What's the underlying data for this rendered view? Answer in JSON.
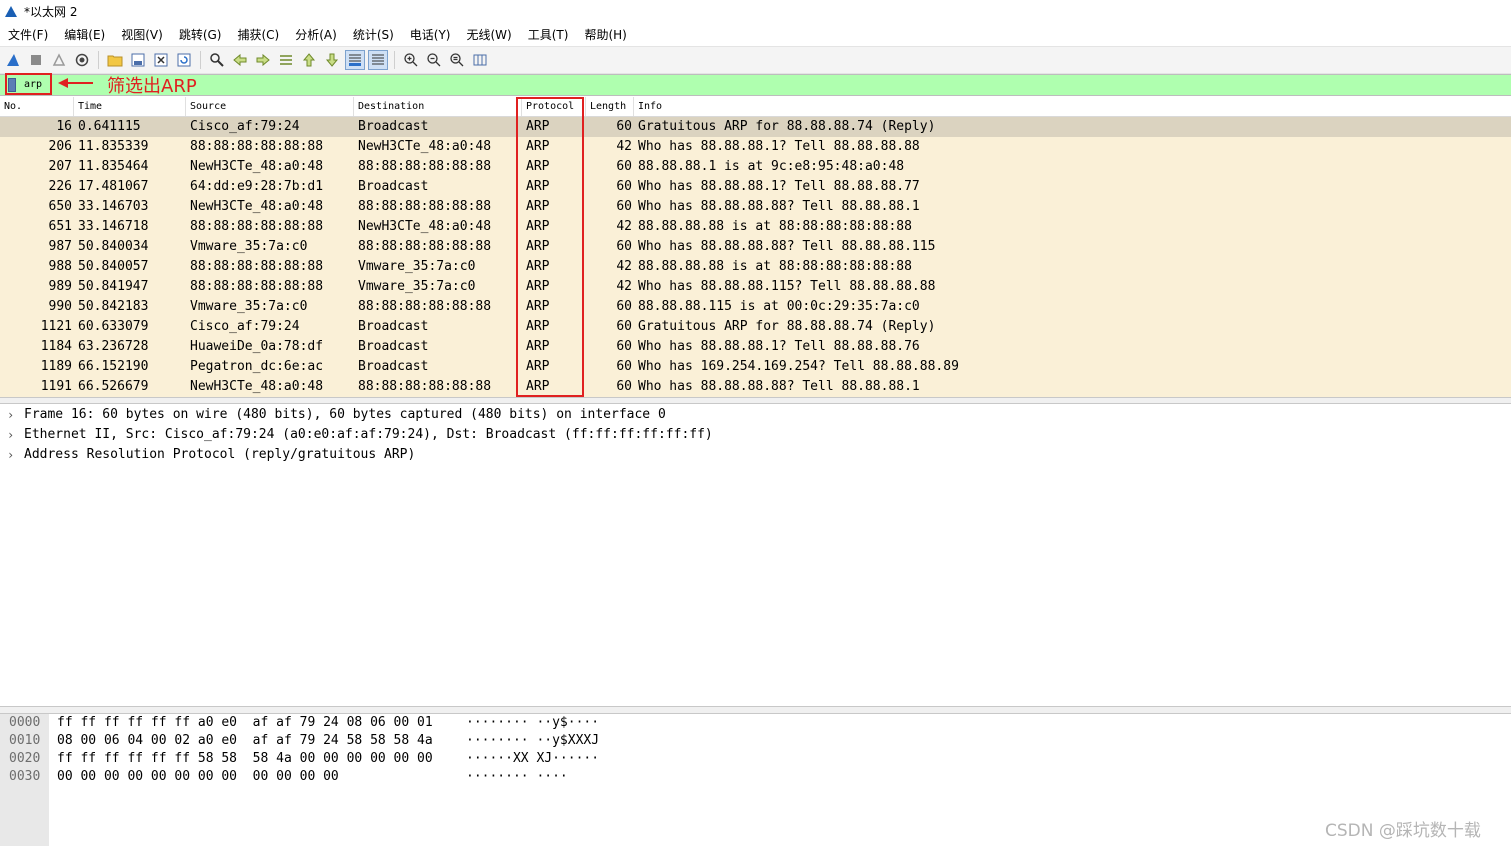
{
  "window": {
    "title": "*以太网 2"
  },
  "menubar": [
    "文件(F)",
    "编辑(E)",
    "视图(V)",
    "跳转(G)",
    "捕获(C)",
    "分析(A)",
    "统计(S)",
    "电话(Y)",
    "无线(W)",
    "工具(T)",
    "帮助(H)"
  ],
  "toolbar": {
    "icons": [
      "shark-fin-start-icon",
      "stop-capture-icon",
      "restart-capture-icon",
      "capture-options-icon",
      "open-file-icon",
      "save-file-icon",
      "close-file-icon",
      "reload-file-icon",
      "find-packet-icon",
      "go-back-icon",
      "go-forward-icon",
      "go-to-packet-icon",
      "go-first-packet-icon",
      "go-last-packet-icon",
      "autoscroll-icon",
      "colorize-icon",
      "zoom-in-icon",
      "zoom-out-icon",
      "zoom-normal-icon",
      "resize-columns-icon"
    ]
  },
  "filter": {
    "value": "arp",
    "bg_color": "#afffaf"
  },
  "annotation": {
    "text": "筛选出ARP",
    "color": "#e02020"
  },
  "packet_list": {
    "columns": [
      "No.",
      "Time",
      "Source",
      "Destination",
      "Protocol",
      "Length",
      "Info"
    ],
    "rows": [
      {
        "no": "16",
        "time": "0.641115",
        "src": "Cisco_af:79:24",
        "dst": "Broadcast",
        "proto": "ARP",
        "len": "60",
        "info": "Gratuitous ARP for 88.88.88.74 (Reply)",
        "selected": true
      },
      {
        "no": "206",
        "time": "11.835339",
        "src": "88:88:88:88:88:88",
        "dst": "NewH3CTe_48:a0:48",
        "proto": "ARP",
        "len": "42",
        "info": "Who has 88.88.88.1? Tell 88.88.88.88"
      },
      {
        "no": "207",
        "time": "11.835464",
        "src": "NewH3CTe_48:a0:48",
        "dst": "88:88:88:88:88:88",
        "proto": "ARP",
        "len": "60",
        "info": "88.88.88.1 is at 9c:e8:95:48:a0:48"
      },
      {
        "no": "226",
        "time": "17.481067",
        "src": "64:dd:e9:28:7b:d1",
        "dst": "Broadcast",
        "proto": "ARP",
        "len": "60",
        "info": "Who has 88.88.88.1? Tell 88.88.88.77"
      },
      {
        "no": "650",
        "time": "33.146703",
        "src": "NewH3CTe_48:a0:48",
        "dst": "88:88:88:88:88:88",
        "proto": "ARP",
        "len": "60",
        "info": "Who has 88.88.88.88? Tell 88.88.88.1"
      },
      {
        "no": "651",
        "time": "33.146718",
        "src": "88:88:88:88:88:88",
        "dst": "NewH3CTe_48:a0:48",
        "proto": "ARP",
        "len": "42",
        "info": "88.88.88.88 is at 88:88:88:88:88:88"
      },
      {
        "no": "987",
        "time": "50.840034",
        "src": "Vmware_35:7a:c0",
        "dst": "88:88:88:88:88:88",
        "proto": "ARP",
        "len": "60",
        "info": "Who has 88.88.88.88? Tell 88.88.88.115"
      },
      {
        "no": "988",
        "time": "50.840057",
        "src": "88:88:88:88:88:88",
        "dst": "Vmware_35:7a:c0",
        "proto": "ARP",
        "len": "42",
        "info": "88.88.88.88 is at 88:88:88:88:88:88"
      },
      {
        "no": "989",
        "time": "50.841947",
        "src": "88:88:88:88:88:88",
        "dst": "Vmware_35:7a:c0",
        "proto": "ARP",
        "len": "42",
        "info": "Who has 88.88.88.115? Tell 88.88.88.88"
      },
      {
        "no": "990",
        "time": "50.842183",
        "src": "Vmware_35:7a:c0",
        "dst": "88:88:88:88:88:88",
        "proto": "ARP",
        "len": "60",
        "info": "88.88.88.115 is at 00:0c:29:35:7a:c0"
      },
      {
        "no": "1121",
        "time": "60.633079",
        "src": "Cisco_af:79:24",
        "dst": "Broadcast",
        "proto": "ARP",
        "len": "60",
        "info": "Gratuitous ARP for 88.88.88.74 (Reply)"
      },
      {
        "no": "1184",
        "time": "63.236728",
        "src": "HuaweiDe_0a:78:df",
        "dst": "Broadcast",
        "proto": "ARP",
        "len": "60",
        "info": "Who has 88.88.88.1? Tell 88.88.88.76"
      },
      {
        "no": "1189",
        "time": "66.152190",
        "src": "Pegatron_dc:6e:ac",
        "dst": "Broadcast",
        "proto": "ARP",
        "len": "60",
        "info": "Who has 169.254.169.254? Tell 88.88.88.89"
      },
      {
        "no": "1191",
        "time": "66.526679",
        "src": "NewH3CTe_48:a0:48",
        "dst": "88:88:88:88:88:88",
        "proto": "ARP",
        "len": "60",
        "info": "Who has 88.88.88.88? Tell 88.88.88.1"
      }
    ]
  },
  "details": [
    "Frame 16: 60 bytes on wire (480 bits), 60 bytes captured (480 bits) on interface 0",
    "Ethernet II, Src: Cisco_af:79:24 (a0:e0:af:af:79:24), Dst: Broadcast (ff:ff:ff:ff:ff:ff)",
    "Address Resolution Protocol (reply/gratuitous ARP)"
  ],
  "bytes": [
    {
      "offset": "0000",
      "hex": "ff ff ff ff ff ff a0 e0  af af 79 24 08 06 00 01",
      "ascii": "········ ··y$····"
    },
    {
      "offset": "0010",
      "hex": "08 00 06 04 00 02 a0 e0  af af 79 24 58 58 58 4a",
      "ascii": "········ ··y$XXXJ"
    },
    {
      "offset": "0020",
      "hex": "ff ff ff ff ff ff 58 58  58 4a 00 00 00 00 00 00",
      "ascii": "······XX XJ······"
    },
    {
      "offset": "0030",
      "hex": "00 00 00 00 00 00 00 00  00 00 00 00",
      "ascii": "········ ····"
    }
  ],
  "watermark": "CSDN @踩坑数十载"
}
